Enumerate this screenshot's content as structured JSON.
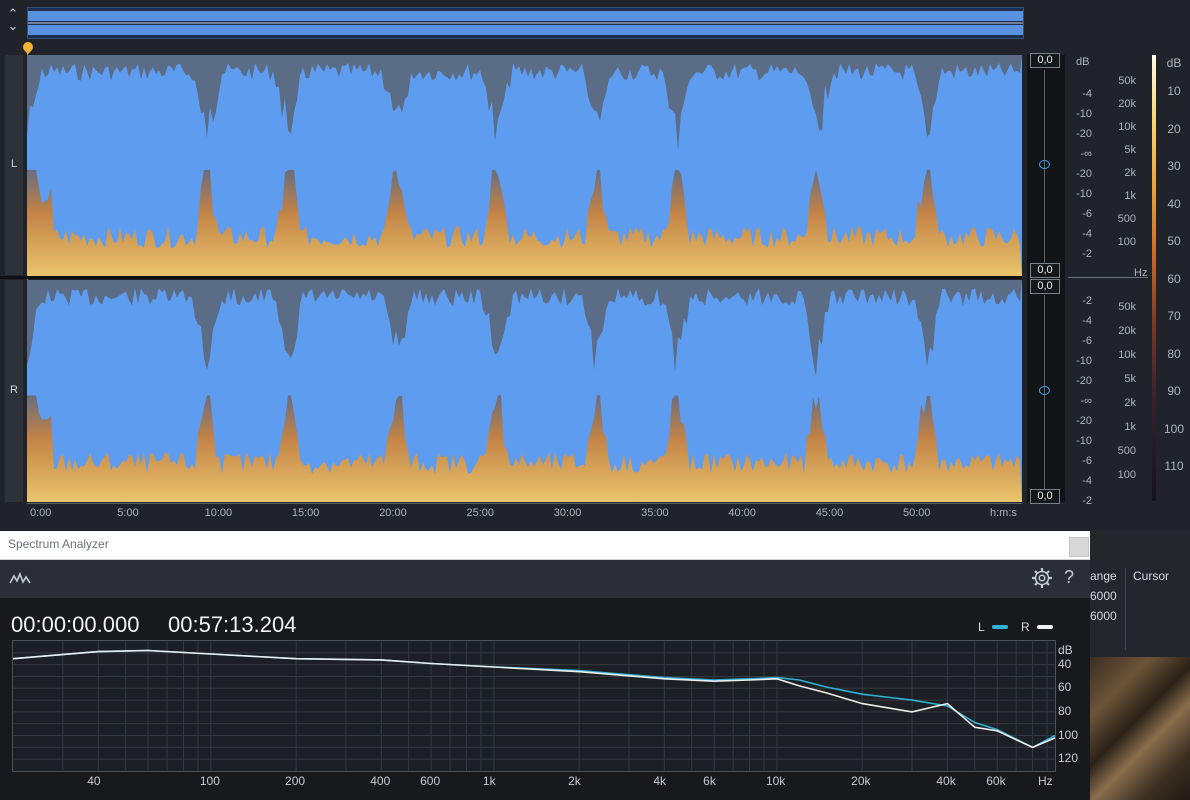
{
  "editor": {
    "channels": [
      {
        "label": "L"
      },
      {
        "label": "R"
      }
    ],
    "zero_value": "0,0",
    "db_header": "dB",
    "db_ticks_l": [
      "-4",
      "-10",
      "-20",
      "-∞",
      "-20",
      "-10",
      "-6",
      "-4",
      "-2"
    ],
    "db_ticks_r": [
      "-2",
      "-4",
      "-6",
      "-10",
      "-20",
      "-∞",
      "-20",
      "-10",
      "-6",
      "-4",
      "-2"
    ],
    "hz_ticks_l": [
      "50k",
      "20k",
      "10k",
      "5k",
      "2k",
      "1k",
      "500",
      "100"
    ],
    "hz_ticks_r": [
      "50k",
      "20k",
      "10k",
      "5k",
      "2k",
      "1k",
      "500",
      "100"
    ],
    "hz_unit": "Hz",
    "colorbar_header": "dB",
    "colorbar_ticks": [
      "10",
      "20",
      "30",
      "40",
      "50",
      "60",
      "70",
      "80",
      "90",
      "100",
      "110"
    ],
    "time_ticks": [
      "0:00",
      "5:00",
      "10:00",
      "15:00",
      "20:00",
      "25:00",
      "30:00",
      "35:00",
      "40:00",
      "45:00",
      "50:00"
    ],
    "time_unit": "h:m:s"
  },
  "spectrum": {
    "window_title": "Spectrum Analyzer",
    "start_time": "00:00:00.000",
    "end_time": "00:57:13.204",
    "legend": [
      {
        "name": "L",
        "color": "#2fb1d8"
      },
      {
        "name": "R",
        "color": "#f0f0f0"
      }
    ],
    "db_unit": "dB",
    "db_ticks": [
      "40",
      "60",
      "80",
      "100",
      "120"
    ],
    "freq_ticks": [
      "40",
      "100",
      "200",
      "400",
      "600",
      "1k",
      "2k",
      "4k",
      "6k",
      "10k",
      "20k",
      "40k",
      "60k",
      "Hz"
    ],
    "icons": {
      "toolbar": "waveform-icon",
      "settings": "gear-icon",
      "help": "help-icon"
    }
  },
  "side_panel": {
    "range_label": "ange",
    "cursor_label": "Cursor",
    "range_values": [
      "6000",
      "6000"
    ]
  },
  "chart_data": {
    "type": "line",
    "xlabel": "Hz",
    "ylabel": "dB",
    "x_scale": "log",
    "x": [
      20,
      40,
      60,
      100,
      200,
      400,
      600,
      1000,
      2000,
      4000,
      6000,
      8000,
      10000,
      12000,
      15000,
      20000,
      30000,
      40000,
      50000,
      60000,
      80000,
      96000
    ],
    "series": [
      {
        "name": "L",
        "values": [
          35,
          29,
          28,
          31,
          35,
          36,
          39,
          42,
          45,
          51,
          53,
          52,
          51,
          53,
          59,
          65,
          70,
          75,
          89,
          95,
          110,
          100
        ]
      },
      {
        "name": "R",
        "values": [
          35,
          29,
          28,
          31,
          35,
          36,
          39,
          42,
          46,
          52,
          54,
          53,
          52,
          58,
          64,
          73,
          80,
          73,
          93,
          96,
          110,
          102
        ]
      }
    ],
    "ylim": [
      130,
      20
    ],
    "grid": true,
    "legend": "top-right"
  }
}
